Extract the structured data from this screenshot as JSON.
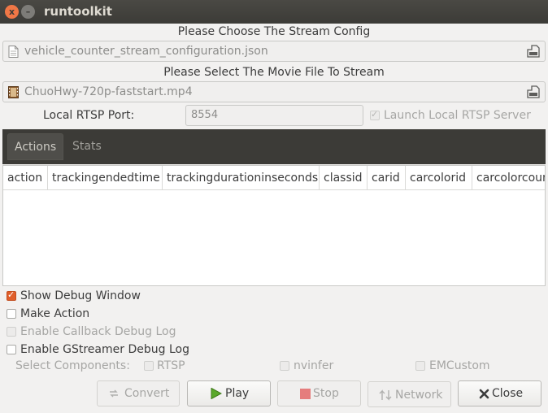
{
  "window": {
    "title": "runtoolkit",
    "close_glyph": "x",
    "minimize_glyph": "–"
  },
  "stream_config": {
    "label": "Please Choose The Stream Config",
    "value": "vehicle_counter_stream_configuration.json",
    "icon": "document-icon",
    "browse_icon": "open-file-icon"
  },
  "movie_file": {
    "label": "Please Select The Movie File To Stream",
    "value": "ChuoHwy-720p-faststart.mp4",
    "icon": "film-icon",
    "browse_icon": "open-file-icon"
  },
  "rtsp": {
    "port_label": "Local RTSP Port:",
    "port_placeholder": "8554",
    "launch_label": "Launch Local RTSP Server",
    "launch_checked": true,
    "launch_enabled": false
  },
  "tabs": [
    {
      "label": "Actions",
      "active": true
    },
    {
      "label": "Stats",
      "active": false
    }
  ],
  "table": {
    "columns": [
      "action",
      "trackingendedtime",
      "trackingdurationinseconds",
      "classid",
      "carid",
      "carcolorid",
      "carcolorcount"
    ],
    "rows": []
  },
  "options": {
    "show_debug_window": {
      "label": "Show Debug Window",
      "checked": true
    },
    "make_action": {
      "label": "Make Action",
      "checked": false
    },
    "enable_callback_debug_log": {
      "label": "Enable Callback Debug Log",
      "checked": false,
      "enabled": false
    },
    "enable_gstreamer_debug_log": {
      "label": "Enable GStreamer Debug Log",
      "checked": false
    }
  },
  "components": {
    "label": "Select Components:",
    "items": [
      {
        "label": "RTSP",
        "checked": false
      },
      {
        "label": "nvinfer",
        "checked": false
      },
      {
        "label": "EMCustom",
        "checked": false
      }
    ]
  },
  "buttons": {
    "convert": {
      "label": "Convert",
      "enabled": false,
      "icon": "convert-icon"
    },
    "play": {
      "label": "Play",
      "enabled": true,
      "icon": "play-icon"
    },
    "stop": {
      "label": "Stop",
      "enabled": false,
      "icon": "stop-icon"
    },
    "network": {
      "label": "Network",
      "enabled": false,
      "icon": "network-icon"
    },
    "close": {
      "label": "Close",
      "enabled": true,
      "icon": "close-icon"
    }
  },
  "colors": {
    "accent": "#e05e2a",
    "play_green": "#4e9a06",
    "stop_red": "#e06c6c",
    "titlebar": "#3c3b37"
  }
}
